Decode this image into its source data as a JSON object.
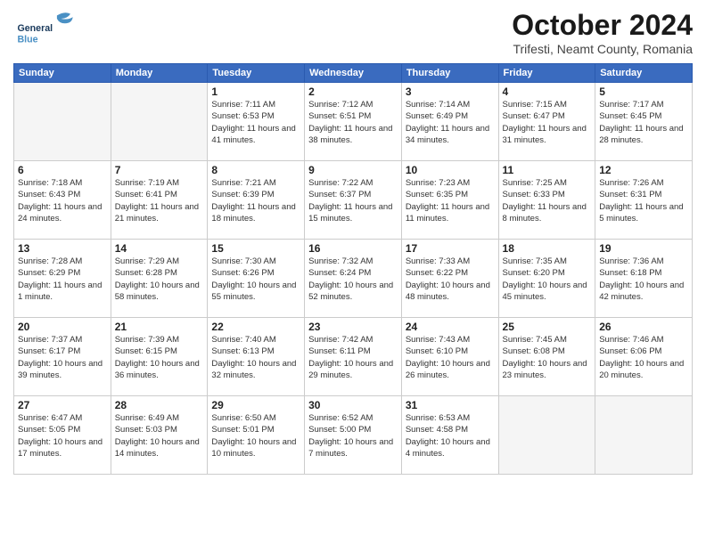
{
  "header": {
    "logo_general": "General",
    "logo_blue": "Blue",
    "month_title": "October 2024",
    "location": "Trifesti, Neamt County, Romania"
  },
  "days_of_week": [
    "Sunday",
    "Monday",
    "Tuesday",
    "Wednesday",
    "Thursday",
    "Friday",
    "Saturday"
  ],
  "weeks": [
    [
      {
        "day": "",
        "info": ""
      },
      {
        "day": "",
        "info": ""
      },
      {
        "day": "1",
        "info": "Sunrise: 7:11 AM\nSunset: 6:53 PM\nDaylight: 11 hours and 41 minutes."
      },
      {
        "day": "2",
        "info": "Sunrise: 7:12 AM\nSunset: 6:51 PM\nDaylight: 11 hours and 38 minutes."
      },
      {
        "day": "3",
        "info": "Sunrise: 7:14 AM\nSunset: 6:49 PM\nDaylight: 11 hours and 34 minutes."
      },
      {
        "day": "4",
        "info": "Sunrise: 7:15 AM\nSunset: 6:47 PM\nDaylight: 11 hours and 31 minutes."
      },
      {
        "day": "5",
        "info": "Sunrise: 7:17 AM\nSunset: 6:45 PM\nDaylight: 11 hours and 28 minutes."
      }
    ],
    [
      {
        "day": "6",
        "info": "Sunrise: 7:18 AM\nSunset: 6:43 PM\nDaylight: 11 hours and 24 minutes."
      },
      {
        "day": "7",
        "info": "Sunrise: 7:19 AM\nSunset: 6:41 PM\nDaylight: 11 hours and 21 minutes."
      },
      {
        "day": "8",
        "info": "Sunrise: 7:21 AM\nSunset: 6:39 PM\nDaylight: 11 hours and 18 minutes."
      },
      {
        "day": "9",
        "info": "Sunrise: 7:22 AM\nSunset: 6:37 PM\nDaylight: 11 hours and 15 minutes."
      },
      {
        "day": "10",
        "info": "Sunrise: 7:23 AM\nSunset: 6:35 PM\nDaylight: 11 hours and 11 minutes."
      },
      {
        "day": "11",
        "info": "Sunrise: 7:25 AM\nSunset: 6:33 PM\nDaylight: 11 hours and 8 minutes."
      },
      {
        "day": "12",
        "info": "Sunrise: 7:26 AM\nSunset: 6:31 PM\nDaylight: 11 hours and 5 minutes."
      }
    ],
    [
      {
        "day": "13",
        "info": "Sunrise: 7:28 AM\nSunset: 6:29 PM\nDaylight: 11 hours and 1 minute."
      },
      {
        "day": "14",
        "info": "Sunrise: 7:29 AM\nSunset: 6:28 PM\nDaylight: 10 hours and 58 minutes."
      },
      {
        "day": "15",
        "info": "Sunrise: 7:30 AM\nSunset: 6:26 PM\nDaylight: 10 hours and 55 minutes."
      },
      {
        "day": "16",
        "info": "Sunrise: 7:32 AM\nSunset: 6:24 PM\nDaylight: 10 hours and 52 minutes."
      },
      {
        "day": "17",
        "info": "Sunrise: 7:33 AM\nSunset: 6:22 PM\nDaylight: 10 hours and 48 minutes."
      },
      {
        "day": "18",
        "info": "Sunrise: 7:35 AM\nSunset: 6:20 PM\nDaylight: 10 hours and 45 minutes."
      },
      {
        "day": "19",
        "info": "Sunrise: 7:36 AM\nSunset: 6:18 PM\nDaylight: 10 hours and 42 minutes."
      }
    ],
    [
      {
        "day": "20",
        "info": "Sunrise: 7:37 AM\nSunset: 6:17 PM\nDaylight: 10 hours and 39 minutes."
      },
      {
        "day": "21",
        "info": "Sunrise: 7:39 AM\nSunset: 6:15 PM\nDaylight: 10 hours and 36 minutes."
      },
      {
        "day": "22",
        "info": "Sunrise: 7:40 AM\nSunset: 6:13 PM\nDaylight: 10 hours and 32 minutes."
      },
      {
        "day": "23",
        "info": "Sunrise: 7:42 AM\nSunset: 6:11 PM\nDaylight: 10 hours and 29 minutes."
      },
      {
        "day": "24",
        "info": "Sunrise: 7:43 AM\nSunset: 6:10 PM\nDaylight: 10 hours and 26 minutes."
      },
      {
        "day": "25",
        "info": "Sunrise: 7:45 AM\nSunset: 6:08 PM\nDaylight: 10 hours and 23 minutes."
      },
      {
        "day": "26",
        "info": "Sunrise: 7:46 AM\nSunset: 6:06 PM\nDaylight: 10 hours and 20 minutes."
      }
    ],
    [
      {
        "day": "27",
        "info": "Sunrise: 6:47 AM\nSunset: 5:05 PM\nDaylight: 10 hours and 17 minutes."
      },
      {
        "day": "28",
        "info": "Sunrise: 6:49 AM\nSunset: 5:03 PM\nDaylight: 10 hours and 14 minutes."
      },
      {
        "day": "29",
        "info": "Sunrise: 6:50 AM\nSunset: 5:01 PM\nDaylight: 10 hours and 10 minutes."
      },
      {
        "day": "30",
        "info": "Sunrise: 6:52 AM\nSunset: 5:00 PM\nDaylight: 10 hours and 7 minutes."
      },
      {
        "day": "31",
        "info": "Sunrise: 6:53 AM\nSunset: 4:58 PM\nDaylight: 10 hours and 4 minutes."
      },
      {
        "day": "",
        "info": ""
      },
      {
        "day": "",
        "info": ""
      }
    ]
  ]
}
